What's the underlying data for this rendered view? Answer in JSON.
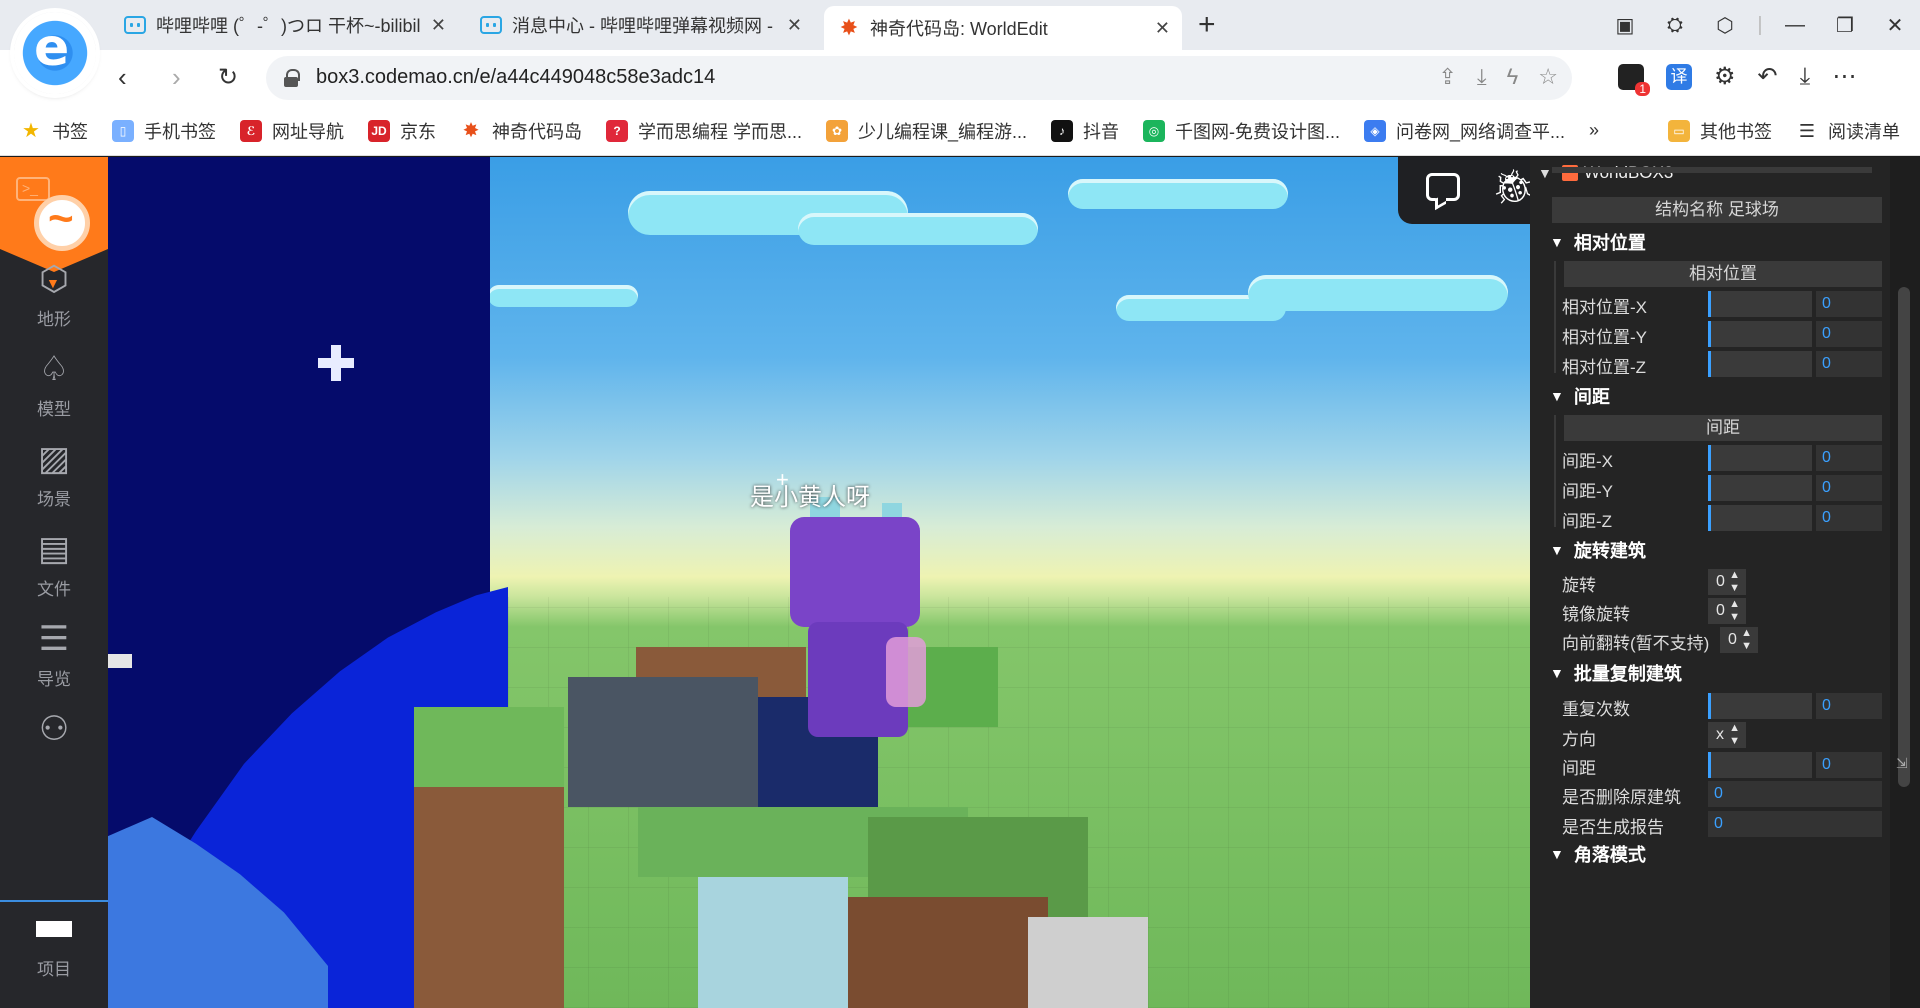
{
  "browser": {
    "tabs": [
      {
        "title": "哔哩哔哩 (゜-゜)つロ 干杯~-bilibili",
        "icon": "bilibili-icon"
      },
      {
        "title": "消息中心 - 哔哩哔哩弹幕视频网 - ",
        "icon": "bilibili-icon"
      },
      {
        "title": "神奇代码岛: WorldEdit",
        "icon": "codemao-star-icon"
      }
    ],
    "new_tab": "+",
    "url": "box3.codemao.cn/e/a44c449048c58e3adc14",
    "window_controls": [
      "minimize",
      "restore",
      "close"
    ],
    "bookmarks": [
      {
        "label": "书签",
        "icon": "star-icon"
      },
      {
        "label": "手机书签",
        "icon": "phone-icon"
      },
      {
        "label": "网址导航",
        "icon": "nav-icon"
      },
      {
        "label": "京东",
        "icon": "jd-icon"
      },
      {
        "label": "神奇代码岛",
        "icon": "codemao-star-icon"
      },
      {
        "label": "学而思编程 学而思...",
        "icon": "xes-icon"
      },
      {
        "label": "少儿编程课_编程游...",
        "icon": "kids-icon"
      },
      {
        "label": "抖音",
        "icon": "douyin-icon"
      },
      {
        "label": "千图网-免费设计图...",
        "icon": "qiantu-icon"
      },
      {
        "label": "问卷网_网络调查平...",
        "icon": "wenjuan-icon"
      }
    ],
    "bookmarks_more": "»",
    "other_bookmarks": "其他书签",
    "reading_list": "阅读清单",
    "extension_badge": "1",
    "translate_label": "译"
  },
  "sidebar": {
    "items": [
      {
        "label": "地形",
        "icon": "cube-icon"
      },
      {
        "label": "模型",
        "icon": "tree-icon"
      },
      {
        "label": "场景",
        "icon": "image-icon"
      },
      {
        "label": "文件",
        "icon": "file-icon"
      },
      {
        "label": "导览",
        "icon": "list-icon"
      },
      {
        "label": "",
        "icon": "users-icon"
      },
      {
        "label": "项目",
        "icon": "project-icon"
      }
    ]
  },
  "viewport": {
    "player_name": "是小黄人呀",
    "crosshair": "+"
  },
  "panel": {
    "title": "WorldBOX3",
    "structure_name_btn": "结构名称 足球场",
    "sections": {
      "relative": {
        "title": "相对位置",
        "button": "相对位置",
        "rows": [
          {
            "label": "相对位置-X",
            "value": "0"
          },
          {
            "label": "相对位置-Y",
            "value": "0"
          },
          {
            "label": "相对位置-Z",
            "value": "0"
          }
        ]
      },
      "spacing": {
        "title": "间距",
        "button": "间距",
        "rows": [
          {
            "label": "间距-X",
            "value": "0"
          },
          {
            "label": "间距-Y",
            "value": "0"
          },
          {
            "label": "间距-Z",
            "value": "0"
          }
        ]
      },
      "rotate": {
        "title": "旋转建筑",
        "rows": [
          {
            "label": "旋转",
            "value": "0"
          },
          {
            "label": "镜像旋转",
            "value": "0"
          },
          {
            "label": "向前翻转(暂不支持)",
            "value": "0"
          }
        ]
      },
      "batch": {
        "title": "批量复制建筑",
        "repeat_label": "重复次数",
        "repeat_value": "0",
        "direction_label": "方向",
        "direction_value": "x",
        "spacing_label": "间距",
        "spacing_value": "0",
        "delete_label": "是否删除原建筑",
        "delete_value": "0",
        "report_label": "是否生成报告",
        "report_value": "0"
      }
    },
    "next_section": "角落模式"
  }
}
